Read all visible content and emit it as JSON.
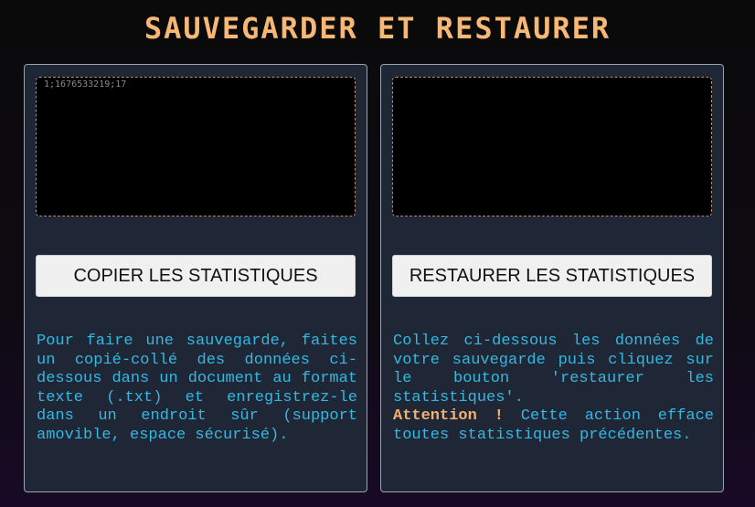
{
  "title": "SAUVEGARDER ET RESTAURER",
  "backup": {
    "data_value": "1;1676533219;17",
    "button_label": "COPIER LES STATISTIQUES",
    "description": "Pour faire une sauvegarde, faites un copié-collé des données ci-dessous dans un document au format texte (.txt) et enregistrez-le dans un endroit sûr (support amovible, espace sécurisé)."
  },
  "restore": {
    "data_value": "",
    "button_label": "RESTAURER LES STATISTIQUES",
    "description": "Collez ci-dessous les données de votre sauvegarde puis cliquez sur le bouton 'restaurer les statistiques'.",
    "warning_label": "Attention !",
    "warning_text": "Cette action efface toutes statistiques précédentes."
  },
  "colors": {
    "title": "#f6b874",
    "panel_bg": "#1f2736",
    "description_text": "#35b7e0",
    "warning": "#f0b070",
    "button_bg": "#f0f0f0"
  }
}
